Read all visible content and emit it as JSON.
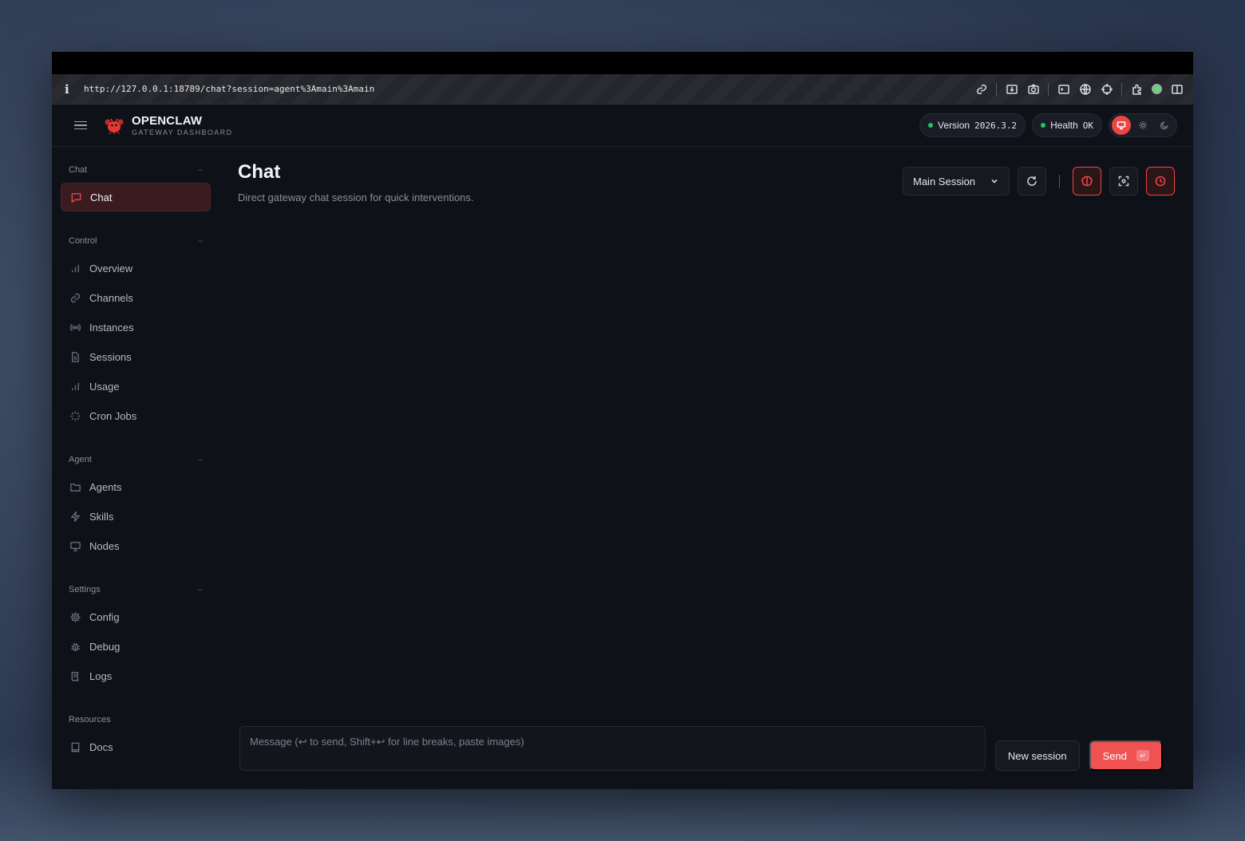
{
  "browser": {
    "url": "http://127.0.0.1:18789/chat?session=agent%3Amain%3Amain"
  },
  "header": {
    "brand_title": "OPENCLAW",
    "brand_subtitle": "GATEWAY DASHBOARD",
    "version_label": "Version",
    "version_value": "2026.3.2",
    "health_label": "Health",
    "health_value": "OK"
  },
  "sidebar": {
    "groups": [
      {
        "title": "Chat",
        "items": [
          {
            "label": "Chat",
            "icon": "message-icon",
            "active": true
          }
        ]
      },
      {
        "title": "Control",
        "items": [
          {
            "label": "Overview",
            "icon": "bar-chart-icon"
          },
          {
            "label": "Channels",
            "icon": "link-icon"
          },
          {
            "label": "Instances",
            "icon": "broadcast-icon"
          },
          {
            "label": "Sessions",
            "icon": "file-icon"
          },
          {
            "label": "Usage",
            "icon": "bar-chart-icon"
          },
          {
            "label": "Cron Jobs",
            "icon": "loader-icon"
          }
        ]
      },
      {
        "title": "Agent",
        "items": [
          {
            "label": "Agents",
            "icon": "folder-icon"
          },
          {
            "label": "Skills",
            "icon": "zap-icon"
          },
          {
            "label": "Nodes",
            "icon": "monitor-icon"
          }
        ]
      },
      {
        "title": "Settings",
        "items": [
          {
            "label": "Config",
            "icon": "gear-icon"
          },
          {
            "label": "Debug",
            "icon": "bug-icon"
          },
          {
            "label": "Logs",
            "icon": "scroll-icon"
          }
        ]
      },
      {
        "title": "Resources",
        "items": [
          {
            "label": "Docs",
            "icon": "book-icon"
          }
        ]
      }
    ]
  },
  "main": {
    "title": "Chat",
    "subtitle": "Direct gateway chat session for quick interventions.",
    "session_select": "Main Session",
    "composer": {
      "placeholder": "Message (↩ to send, Shift+↩ for line breaks, paste images)",
      "new_session_label": "New session",
      "send_label": "Send",
      "send_kbd": "↵"
    }
  },
  "colors": {
    "accent": "#ef4444",
    "background": "#0f1118",
    "status_ok": "#22c55e"
  }
}
